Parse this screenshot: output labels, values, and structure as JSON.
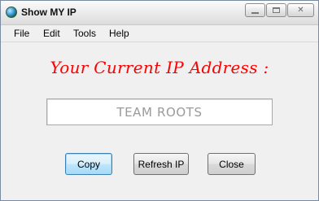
{
  "window": {
    "title": "Show MY IP"
  },
  "menu": {
    "items": [
      "File",
      "Edit",
      "Tools",
      "Help"
    ]
  },
  "main": {
    "headline": "Your Current IP Address :",
    "ip_value": "TEAM ROOTS"
  },
  "buttons": {
    "copy_label": "Copy",
    "refresh_label": "Refresh IP",
    "close_label": "Close"
  },
  "colors": {
    "headline": "#ff0000",
    "ip_text": "#9a9a9a",
    "default_button_border": "#3c7fb1"
  },
  "icons": {
    "app": "globe-icon",
    "minimize": "minimize-icon",
    "maximize": "maximize-icon",
    "close": "close-icon"
  }
}
